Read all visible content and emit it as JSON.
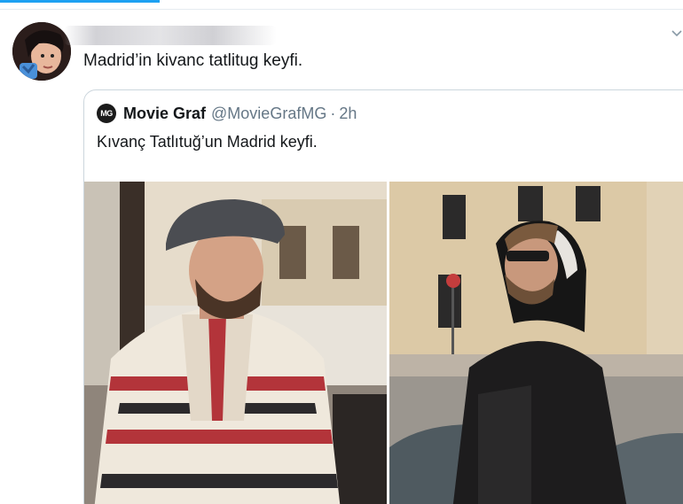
{
  "tweet": {
    "text": "Madrid’in kivanc tatlitug keyfi."
  },
  "quoted_tweet": {
    "logo_text": "MG",
    "author_name": "Movie Graf",
    "handle": "@MovieGrafMG",
    "separator": "·",
    "time": "2h",
    "text": "Kıvanç Tatlıtuğ’un Madrid keyfi."
  },
  "colors": {
    "accent": "#1da1f2",
    "text": "#14171a",
    "secondary_text": "#657786",
    "border": "#ccd6dd"
  },
  "icons": {
    "caret": "chevron-down-icon"
  }
}
